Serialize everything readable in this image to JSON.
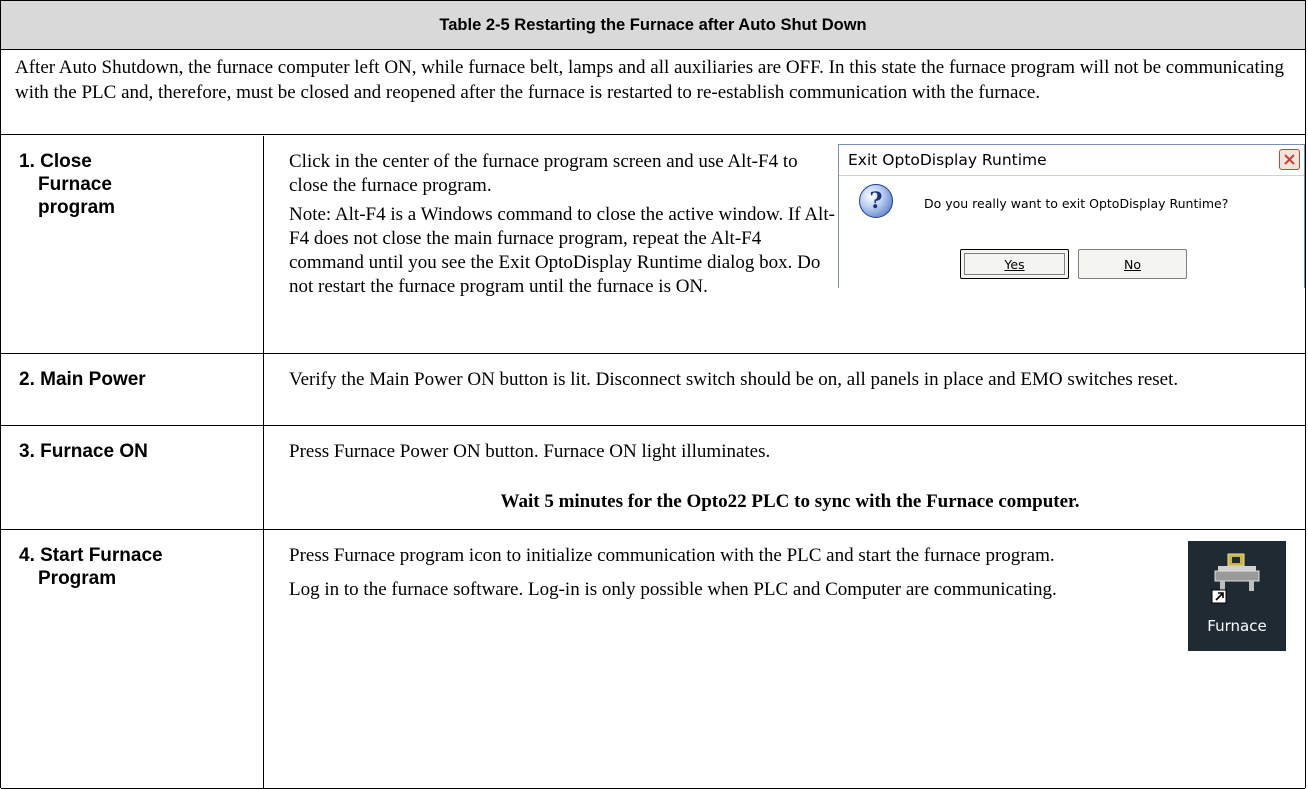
{
  "table": {
    "title": "Table 2-5 Restarting the Furnace after Auto Shut Down",
    "intro": "After Auto Shutdown, the furnace computer left ON, while furnace belt, lamps and all auxiliaries are OFF.  In this state the furnace program will not be communicating with the PLC and, therefore, must be closed and reopened after the furnace is restarted to re-establish communication with the furnace."
  },
  "steps": [
    {
      "label_line1": "1. Close",
      "label_line2": "Furnace",
      "label_line3": "program",
      "paragraph1": "Click in the center of the furnace program screen and use Alt-F4 to close the furnace program.",
      "paragraph2": "Note: Alt-F4 is a Windows command to close the active window.  If Alt-F4 does not close the main furnace program, repeat the Alt-F4 command until you see the Exit OptoDisplay Runtime dialog box. Do not restart the furnace program until the furnace is ON."
    },
    {
      "label_line1": "2. Main Power",
      "paragraph1": "Verify the Main Power ON button is lit.  Disconnect switch should be on, all panels in place and EMO switches reset."
    },
    {
      "label_line1": "3. Furnace ON",
      "paragraph1": "Press Furnace Power ON button. Furnace ON light illuminates.",
      "emphasis": "Wait 5 minutes for the Opto22 PLC to sync with the Furnace computer."
    },
    {
      "label_line1": "4. Start Furnace",
      "label_line2": "Program",
      "paragraph1": "Press Furnace program icon to initialize communication with the PLC and start the furnace program.",
      "paragraph2": "Log in to the furnace software.  Log-in is only possible when PLC and Computer are communicating."
    }
  ],
  "dialog": {
    "title": "Exit OptoDisplay Runtime",
    "message": "Do you really want to exit OptoDisplay Runtime?",
    "yes_label": "Yes",
    "no_label": "No",
    "icon": "question-icon",
    "close_icon": "close-icon"
  },
  "desktop_icon": {
    "label": "Furnace",
    "icon": "furnace-shortcut-icon"
  },
  "colors": {
    "title_background": "#d9d9d9",
    "dialog_border": "#7b8fb8",
    "icon_background": "#1f2a33"
  }
}
